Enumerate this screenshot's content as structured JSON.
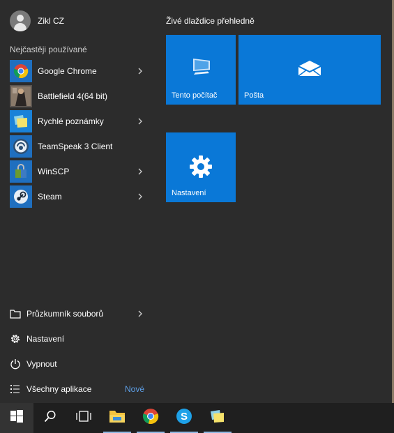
{
  "user": {
    "name": "Zikl CZ"
  },
  "most_used": {
    "label": "Nejčastěji používané",
    "apps": [
      {
        "name": "Google Chrome",
        "icon": "chrome-icon",
        "has_submenu": true
      },
      {
        "name": "Battlefield 4(64 bit)",
        "icon": "battlefield-icon",
        "has_submenu": false
      },
      {
        "name": "Rychlé poznámky",
        "icon": "sticky-notes-icon",
        "has_submenu": true
      },
      {
        "name": "TeamSpeak 3 Client",
        "icon": "teamspeak-icon",
        "has_submenu": false
      },
      {
        "name": "WinSCP",
        "icon": "winscp-icon",
        "has_submenu": true
      },
      {
        "name": "Steam",
        "icon": "steam-icon",
        "has_submenu": true
      }
    ]
  },
  "bottom": {
    "file_explorer": "Průzkumník souborů",
    "settings": "Nastavení",
    "power": "Vypnout",
    "all_apps": "Všechny aplikace",
    "all_apps_badge": "Nové"
  },
  "tiles": {
    "header": "Živé dlaždice přehledně",
    "this_pc": "Tento počítač",
    "mail": "Pošta",
    "settings": "Nastavení"
  },
  "colors": {
    "accent": "#0a78d7",
    "menu_bg": "#2b2b2b",
    "taskbar_bg": "#1f1f1f",
    "new_badge": "#5ea0e8"
  },
  "taskbar": [
    "windows-start-icon",
    "search-icon",
    "task-view-icon",
    "file-explorer-icon",
    "chrome-icon",
    "skype-icon",
    "sticky-notes-icon"
  ]
}
